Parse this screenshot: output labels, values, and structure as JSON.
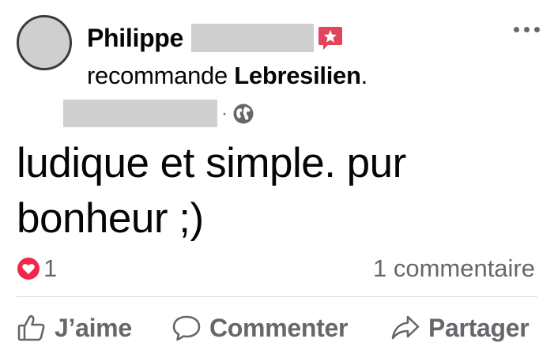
{
  "post": {
    "author_name": "Philippe",
    "recommend_verb": "recommande",
    "page_name": "Lebresilien",
    "page_suffix": ".",
    "separator": "·",
    "privacy_icon": "globe-icon",
    "badge_icon": "recommendation-star-icon",
    "body": "ludique et simple. pur bonheur ;)",
    "reaction_icon": "love-heart-icon",
    "reaction_count": "1",
    "comments_count": "1 commentaire"
  },
  "actions": {
    "like_label": "J’aime",
    "comment_label": "Commenter",
    "share_label": "Partager"
  },
  "colors": {
    "text_primary": "#050505",
    "text_secondary": "#65676b",
    "badge_red": "#e0455c",
    "love_red": "#f02849",
    "redaction_gray": "#cfcfcf"
  }
}
